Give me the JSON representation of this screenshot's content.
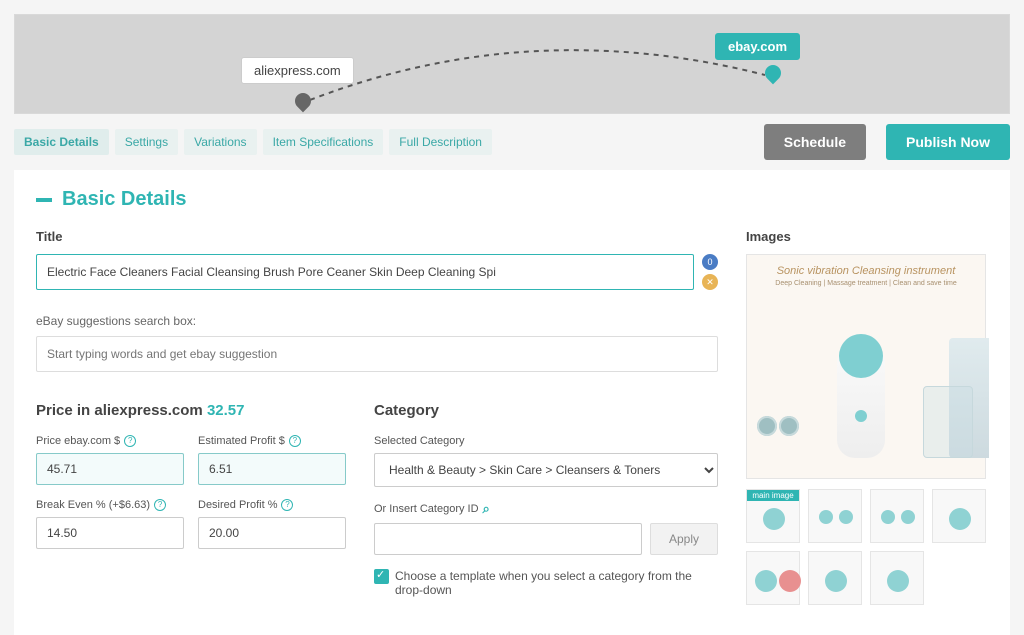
{
  "map": {
    "source": "aliexpress.com",
    "destination": "ebay.com"
  },
  "tabs": {
    "basic": "Basic Details",
    "settings": "Settings",
    "variations": "Variations",
    "specs": "Item Specifications",
    "desc": "Full Description"
  },
  "actions": {
    "schedule": "Schedule",
    "publish": "Publish Now"
  },
  "section_title": "Basic Details",
  "title": {
    "label": "Title",
    "value": "Electric Face Cleaners Facial Cleansing Brush Pore Ceaner Skin Deep Cleaning Spi",
    "badge0": "0"
  },
  "suggest": {
    "label": "eBay suggestions search box:",
    "placeholder": "Start typing words and get ebay suggestion"
  },
  "price": {
    "heading_prefix": "Price in aliexpress.com ",
    "heading_value": "32.57",
    "ebay_label": "Price ebay.com $",
    "ebay_value": "45.71",
    "profit_label": "Estimated Profit $",
    "profit_value": "6.51",
    "break_label": "Break Even % (+$6.63)",
    "break_value": "14.50",
    "desired_label": "Desired Profit %",
    "desired_value": "20.00"
  },
  "category": {
    "heading": "Category",
    "selected_label": "Selected Category",
    "selected_value": "Health & Beauty > Skin Care > Cleansers & Toners",
    "insert_label": "Or Insert Category ID",
    "apply": "Apply",
    "checkbox_label": "Choose a template when you select a category from the drop-down"
  },
  "images": {
    "label": "Images",
    "main_title": "Sonic vibration Cleansing instrument",
    "main_sub": "Deep Cleaning | Massage treatment | Clean and save time",
    "main_tag": "main image"
  }
}
